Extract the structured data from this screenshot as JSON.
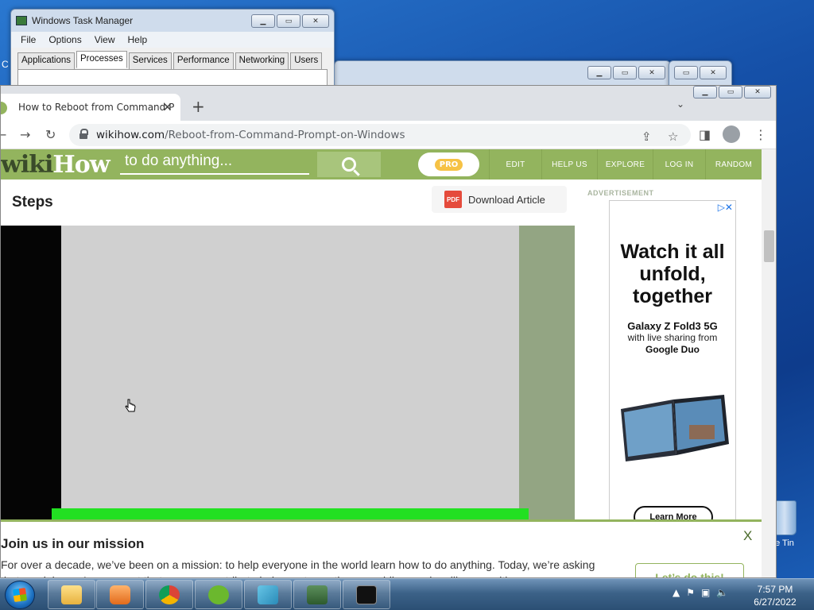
{
  "desktop": {
    "recycle_bin_label": "e Tin",
    "left_fragment": "C"
  },
  "task_manager": {
    "title": "Windows Task Manager",
    "menu": [
      "File",
      "Options",
      "View",
      "Help"
    ],
    "tabs": [
      "Applications",
      "Processes",
      "Services",
      "Performance",
      "Networking",
      "Users"
    ],
    "active_tab": "Processes"
  },
  "chrome": {
    "tab_title": "How to Reboot from Command P",
    "new_tab_symbol": "+",
    "url_host": "wikihow.com",
    "url_path": "/Reboot-from-Command-Prompt-on-Windows"
  },
  "wikihow": {
    "logo_wiki": "wiki",
    "logo_how": "How",
    "search_placeholder": "to do anything...",
    "pro_label": "PRO",
    "nav": [
      "EDIT",
      "HELP US",
      "EXPLORE",
      "LOG IN",
      "RANDOM"
    ],
    "steps_heading": "Steps",
    "download_label": "Download Article",
    "pdf_label": "PDF",
    "ad_label": "ADVERTISEMENT"
  },
  "ad": {
    "headline": "Watch it all unfold, together",
    "product": "Galaxy Z Fold3 5G",
    "sub": "with live sharing from",
    "partner": "Google Duo",
    "cta": "Learn More"
  },
  "mission": {
    "title": "Join us in our mission",
    "body": "For over a decade, we’ve been on a mission: to help everyone in the world learn how to do anything. Today, we’re asking that you join us. Any amount that you can contribute helps us to continue providing readers like you with",
    "close": "X",
    "cta": "Let’s do this!"
  },
  "taskbar": {
    "time": "7:57 PM",
    "date": "6/27/2022"
  },
  "colors": {
    "wikihow_green": "#93b45e",
    "video_progress": "#22e022"
  }
}
